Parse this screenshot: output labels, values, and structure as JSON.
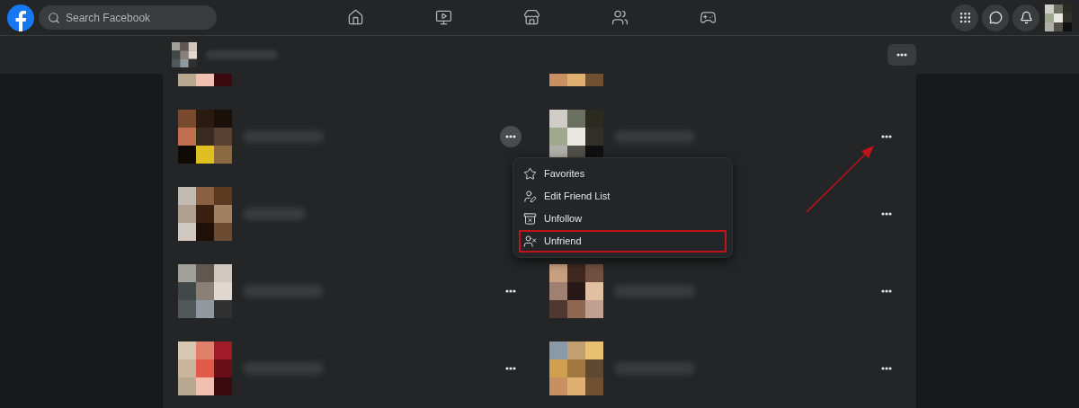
{
  "top_bar": {
    "search": {
      "placeholder": "Search Facebook"
    }
  },
  "friends": [
    {
      "kind": "partial"
    },
    {
      "kind": "partial"
    },
    {
      "kind": "friend",
      "menu_open": true
    },
    {
      "kind": "friend",
      "menu_open": false
    },
    {
      "kind": "covered"
    },
    {
      "kind": "under_menu",
      "menu_open": false
    },
    {
      "kind": "friend",
      "menu_open": false
    },
    {
      "kind": "friend",
      "menu_open": false
    },
    {
      "kind": "friend",
      "menu_open": false
    },
    {
      "kind": "friend",
      "menu_open": false
    }
  ],
  "menu": {
    "items": [
      {
        "kind": "star",
        "label": "Favorites",
        "highlighted": false
      },
      {
        "kind": "edit",
        "label": "Edit Friend List",
        "highlighted": false
      },
      {
        "kind": "unfollow",
        "label": "Unfollow",
        "highlighted": false
      },
      {
        "kind": "unfriend",
        "label": "Unfriend",
        "highlighted": true
      }
    ]
  }
}
